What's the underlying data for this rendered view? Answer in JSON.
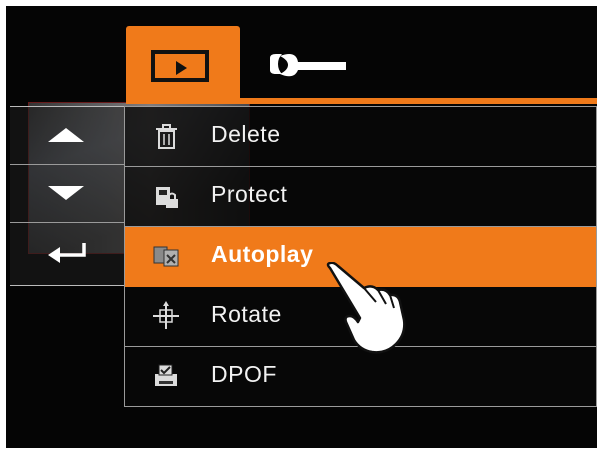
{
  "tabs": [
    {
      "icon": "playback-icon",
      "active": true
    },
    {
      "icon": "wrench-icon",
      "active": false
    }
  ],
  "nav": [
    {
      "icon": "arrow-up-icon"
    },
    {
      "icon": "arrow-down-icon"
    },
    {
      "icon": "enter-return-icon"
    }
  ],
  "menu": {
    "items": [
      {
        "label": "Delete",
        "icon": "trash-icon"
      },
      {
        "label": "Protect",
        "icon": "protect-lock-icon"
      },
      {
        "label": "Autoplay",
        "icon": "slideshow-icon",
        "selected": true
      },
      {
        "label": "Rotate",
        "icon": "rotate-crosshair-icon"
      },
      {
        "label": "DPOF",
        "icon": "print-order-icon"
      }
    ]
  },
  "colors": {
    "accent": "#f07a1a",
    "background": "#050505",
    "text": "#f2f2f2"
  }
}
